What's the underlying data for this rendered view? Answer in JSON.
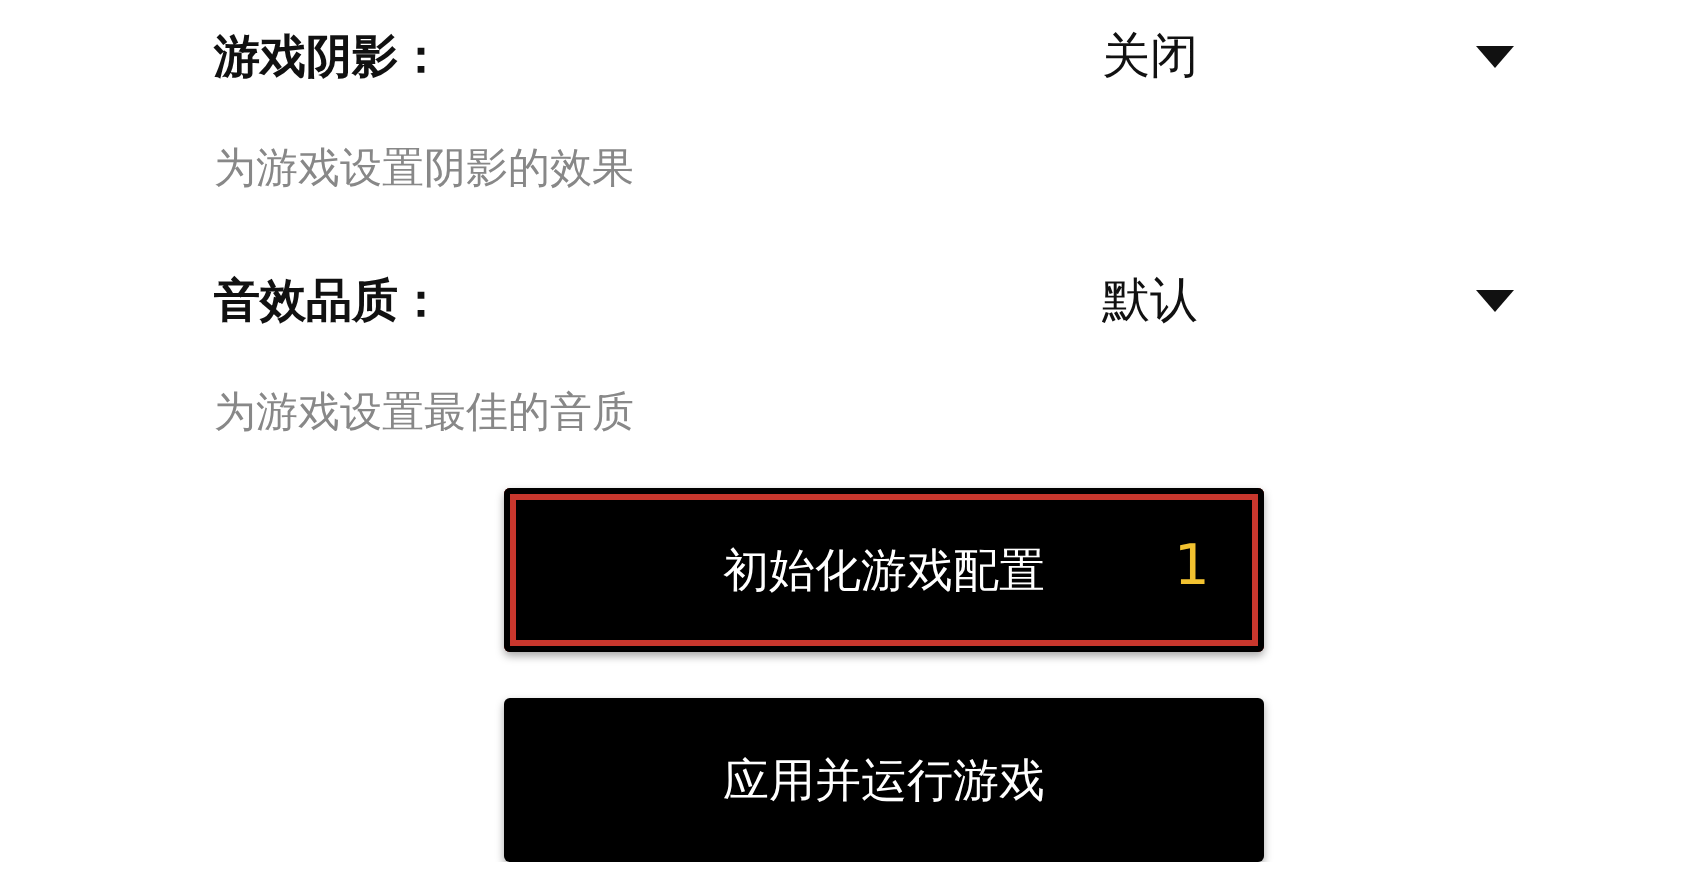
{
  "settings": [
    {
      "label": "游戏阴影：",
      "value": "关闭",
      "description": "为游戏设置阴影的效果"
    },
    {
      "label": "音效品质：",
      "value": "默认",
      "description": "为游戏设置最佳的音质"
    }
  ],
  "buttons": [
    {
      "label": "初始化游戏配置",
      "selected": true,
      "badge": "1"
    },
    {
      "label": "应用并运行游戏",
      "selected": false
    }
  ]
}
